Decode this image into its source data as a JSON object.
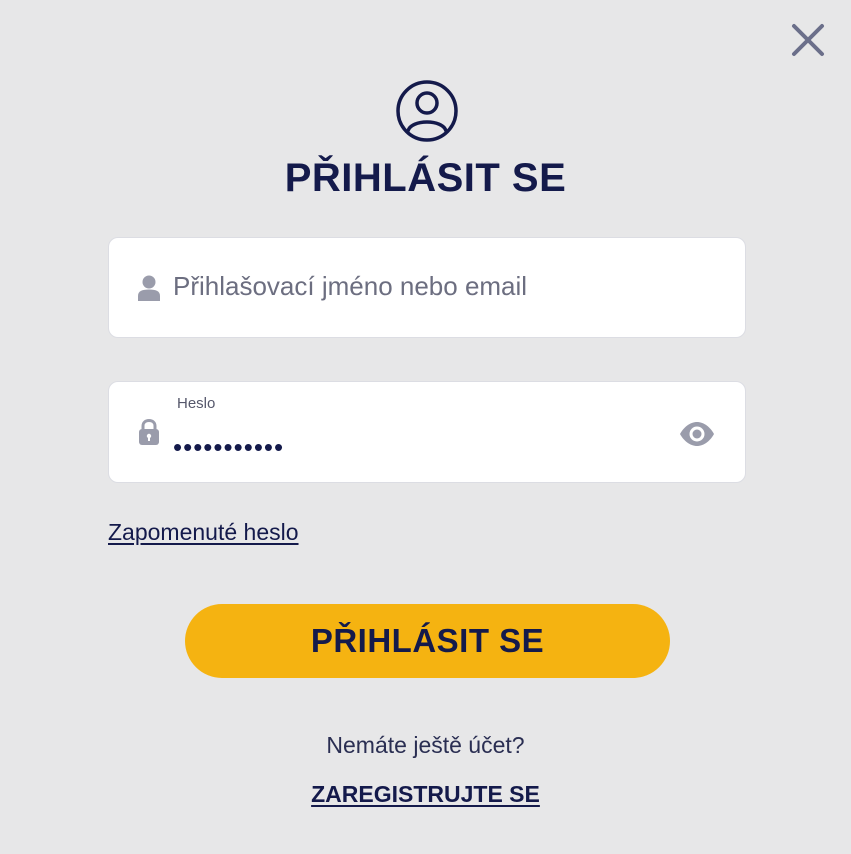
{
  "header": {
    "title": "PŘIHLÁSIT SE"
  },
  "icons": {
    "close": "close-icon",
    "avatar": "user-circle-icon",
    "username": "user-icon",
    "password": "lock-icon",
    "toggle_visibility": "eye-icon"
  },
  "form": {
    "username": {
      "value": "",
      "placeholder": "Přihlašovací jméno nebo email"
    },
    "password": {
      "label": "Heslo",
      "value": "•••••••••••"
    },
    "forgot_password": "Zapomenuté heslo",
    "submit_label": "PŘIHLÁSIT SE"
  },
  "footer": {
    "no_account_text": "Nemáte ještě účet?",
    "register_label": "ZAREGISTRUJTE SE"
  },
  "colors": {
    "background": "#e7e7e8",
    "primary_text": "#141a4b",
    "accent": "#f5b311",
    "icon_gray": "#9a9cab"
  }
}
